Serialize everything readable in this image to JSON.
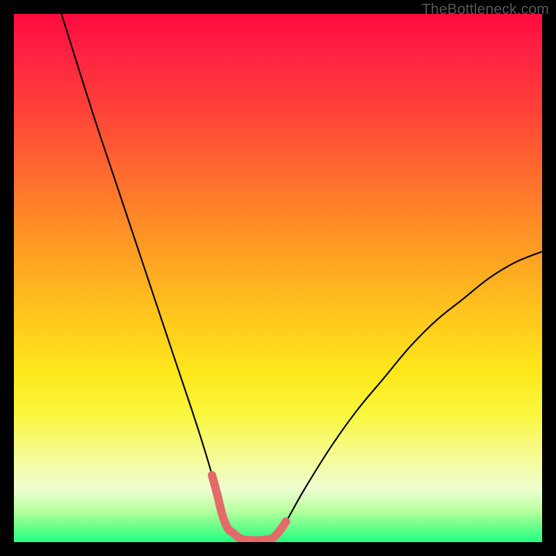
{
  "watermark": "TheBottleneck.com",
  "colors": {
    "frame": "#000000",
    "curve_stroke": "#000000",
    "highlight_stroke": "#e46a6a",
    "gradient_top": "#ff0a3f",
    "gradient_mid1": "#ff9425",
    "gradient_mid2": "#fee81b",
    "gradient_bottom": "#21ff84"
  },
  "chart_data": {
    "type": "line",
    "title": "",
    "xlabel": "",
    "ylabel": "",
    "xlim": [
      0,
      100
    ],
    "ylim": [
      0,
      100
    ],
    "grid": false,
    "legend": false,
    "annotations": [
      "TheBottleneck.com"
    ],
    "series": [
      {
        "name": "bottleneck-curve",
        "comment": "V-shaped curve; values are percent bottleneck. Left branch descends from 100 at x=9 to ~0 near x≈40; flat minimum ~0 over x≈40–50; right branch rises toward ~55 at x=100. Values estimated from pixel positions.",
        "x": [
          9,
          15,
          20,
          25,
          30,
          35,
          38,
          40,
          43,
          46,
          49,
          51,
          55,
          60,
          65,
          70,
          75,
          80,
          85,
          90,
          95,
          100
        ],
        "y": [
          100,
          81,
          66,
          51,
          36,
          21,
          11,
          3,
          0.5,
          0.3,
          0.6,
          3,
          10,
          18,
          25,
          31,
          37,
          42,
          46,
          50,
          53,
          55
        ]
      }
    ],
    "highlight_range_x": [
      37.5,
      51.5
    ]
  }
}
